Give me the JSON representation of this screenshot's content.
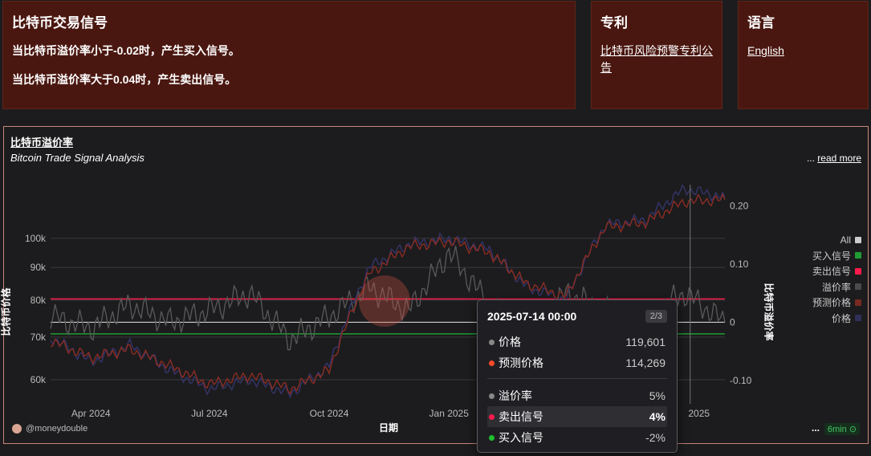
{
  "panels": {
    "signals": {
      "title": "比特币交易信号",
      "line1": "当比特币溢价率小于-0.02时，产生买入信号。",
      "line2": "当比特币溢价率大于0.04时，产生卖出信号。"
    },
    "patent": {
      "title": "专利",
      "link": "比特币风险预警专利公告"
    },
    "language": {
      "title": "语言",
      "link": "English"
    }
  },
  "chart_card": {
    "title": "比特币溢价率",
    "subtitle": "Bitcoin Trade Signal Analysis",
    "read_more_prefix": "...",
    "read_more": "read more",
    "credit": "@moneydouble",
    "more": "...",
    "time_badge": "6min ⊙"
  },
  "chart_data": {
    "type": "line",
    "xlabel": "日期",
    "ylabel_left": "比特币价格",
    "ylabel_right": "比特币溢价率",
    "x_ticks": [
      "Apr 2024",
      "Jul 2024",
      "Oct 2024",
      "Jan 2025",
      "Apr 2025",
      "Jul 2025"
    ],
    "x_tick_visible": [
      "Apr 2024",
      "Jul 2024",
      "Oct 2024",
      "Jan 2025",
      "2025"
    ],
    "y_left_ticks": [
      "100k",
      "90k",
      "80k",
      "70k",
      "60k"
    ],
    "y_left_scale": "log",
    "y_right_ticks": [
      "0.20",
      "0.10",
      "0",
      "-0.10"
    ],
    "thresholds": {
      "sell": 0.04,
      "buy": -0.02
    },
    "legend": [
      {
        "name": "All",
        "color": "#cccccc"
      },
      {
        "name": "买入信号",
        "color": "#1f9d32"
      },
      {
        "name": "卖出信号",
        "color": "#ff1a4b"
      },
      {
        "name": "溢价率",
        "color": "#4a4a4a"
      },
      {
        "name": "预测价格",
        "color": "#7a2a22"
      },
      {
        "name": "价格",
        "color": "#2f2f5a"
      }
    ],
    "series": [
      {
        "name": "价格",
        "x": [
          "2024-03",
          "2024-04",
          "2024-05",
          "2024-06",
          "2024-07",
          "2024-08",
          "2024-09",
          "2024-10",
          "2024-11",
          "2024-12",
          "2025-01",
          "2025-02",
          "2025-03",
          "2025-04",
          "2025-05",
          "2025-06",
          "2025-07",
          "2025-08"
        ],
        "values": [
          70000,
          64000,
          68000,
          62000,
          58000,
          60000,
          57000,
          63000,
          90000,
          98000,
          100000,
          96000,
          84000,
          80000,
          105000,
          107000,
          119601,
          116000
        ]
      },
      {
        "name": "预测价格",
        "x": [
          "2024-03",
          "2024-04",
          "2024-05",
          "2024-06",
          "2024-07",
          "2024-08",
          "2024-09",
          "2024-10",
          "2024-11",
          "2024-12",
          "2025-01",
          "2025-02",
          "2025-03",
          "2025-04",
          "2025-05",
          "2025-06",
          "2025-07",
          "2025-08"
        ],
        "values": [
          69000,
          65000,
          67000,
          63000,
          59000,
          61000,
          58000,
          62000,
          88000,
          97000,
          99000,
          95000,
          85000,
          81000,
          104000,
          106000,
          114269,
          115000
        ]
      },
      {
        "name": "溢价率",
        "x": [
          "2024-03",
          "2024-04",
          "2024-05",
          "2024-06",
          "2024-07",
          "2024-08",
          "2024-09",
          "2024-10",
          "2024-11",
          "2024-12",
          "2025-01",
          "2025-02",
          "2025-03",
          "2025-04",
          "2025-05",
          "2025-06",
          "2025-07",
          "2025-08"
        ],
        "values": [
          0.01,
          -0.01,
          0.03,
          0.0,
          0.02,
          0.05,
          -0.03,
          0.01,
          0.06,
          0.02,
          0.12,
          0.03,
          -0.02,
          0.05,
          0.02,
          0.01,
          0.05,
          0.0
        ]
      }
    ]
  },
  "tooltip": {
    "date": "2025-07-14 00:00",
    "page": "2/3",
    "rows_top": [
      {
        "label": "价格",
        "value": "119,601",
        "color": "#888888"
      },
      {
        "label": "预测价格",
        "value": "114,269",
        "color": "#ff4a2a"
      }
    ],
    "rows_bottom": [
      {
        "label": "溢价率",
        "value": "5%",
        "color": "#888888",
        "highlight": false
      },
      {
        "label": "卖出信号",
        "value": "4%",
        "color": "#ff1a4b",
        "highlight": true
      },
      {
        "label": "买入信号",
        "value": "-2%",
        "color": "#1fc12f",
        "highlight": false
      }
    ]
  }
}
